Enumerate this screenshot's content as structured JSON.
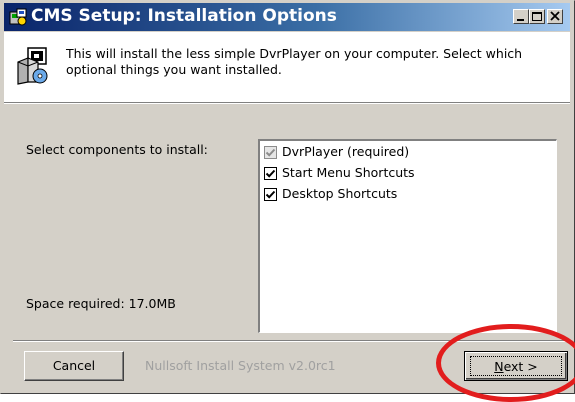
{
  "window": {
    "title": "CMS Setup: Installation Options"
  },
  "header": {
    "description": "This will install the less simple DvrPlayer on your computer. Select which optional things you want installed."
  },
  "main": {
    "select_label": "Select components to install:",
    "components": [
      {
        "label": "DvrPlayer (required)",
        "checked": true,
        "disabled": true
      },
      {
        "label": "Start Menu Shortcuts",
        "checked": true,
        "disabled": false
      },
      {
        "label": "Desktop Shortcuts",
        "checked": true,
        "disabled": false
      }
    ],
    "space_required": "Space required: 17.0MB"
  },
  "footer": {
    "cancel_label": "Cancel",
    "brand_text": "Nullsoft Install System v2.0rc1",
    "next_mnemonic": "N",
    "next_rest": "ext >"
  },
  "colors": {
    "title_gradient_start": "#0a246a",
    "title_gradient_end": "#a6caf0",
    "dialog_bg": "#d4d0c8",
    "highlight_ring": "#e21d1d"
  },
  "icons": [
    "setup-app-icon",
    "installer-box-icon",
    "minimize-icon",
    "maximize-icon",
    "close-icon",
    "checkmark-icon"
  ]
}
